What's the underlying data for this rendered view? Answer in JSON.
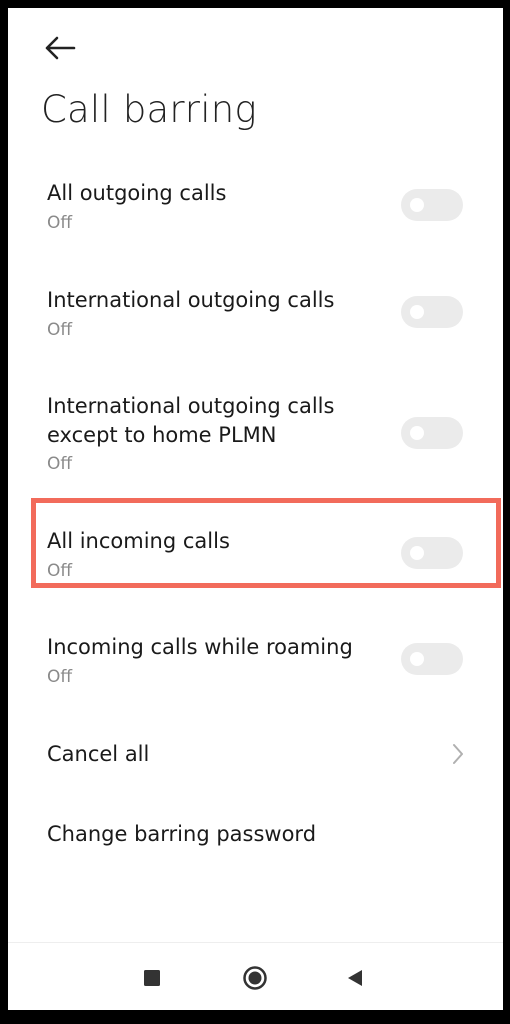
{
  "header": {
    "back_icon": "arrow-left-icon",
    "title": "Call barring"
  },
  "items": [
    {
      "title": "All outgoing calls",
      "status": "Off",
      "toggle": "off"
    },
    {
      "title": "International outgoing calls",
      "status": "Off",
      "toggle": "off"
    },
    {
      "title": "International outgoing calls except to home PLMN",
      "status": "Off",
      "toggle": "off"
    },
    {
      "title": "All incoming calls",
      "status": "Off",
      "toggle": "off",
      "highlighted": true
    },
    {
      "title": "Incoming calls while roaming",
      "status": "Off",
      "toggle": "off"
    }
  ],
  "cancel_all": {
    "label": "Cancel all",
    "icon": "chevron-right-icon"
  },
  "change_password": {
    "label": "Change barring password"
  },
  "nav": {
    "recents_icon": "square-icon",
    "home_icon": "circle-icon",
    "back_icon": "triangle-back-icon"
  },
  "colors": {
    "highlight": "#f26b5b",
    "toggle_off": "#ebebeb"
  }
}
